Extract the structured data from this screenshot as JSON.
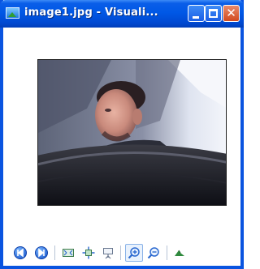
{
  "window": {
    "title": "image1.jpg - Visuali..."
  },
  "toolbar": {
    "buttons": [
      {
        "icon": "previous-icon"
      },
      {
        "icon": "next-icon"
      },
      {
        "icon": "fit-to-window-icon"
      },
      {
        "icon": "actual-size-icon"
      },
      {
        "icon": "slideshow-icon"
      },
      {
        "icon": "zoom-in-icon",
        "selected": true
      },
      {
        "icon": "zoom-out-icon"
      },
      {
        "icon": "rotate-icon"
      }
    ]
  },
  "colors": {
    "titlebar": "#0058e6",
    "border": "#0a54e0",
    "close": "#d24a1e"
  }
}
